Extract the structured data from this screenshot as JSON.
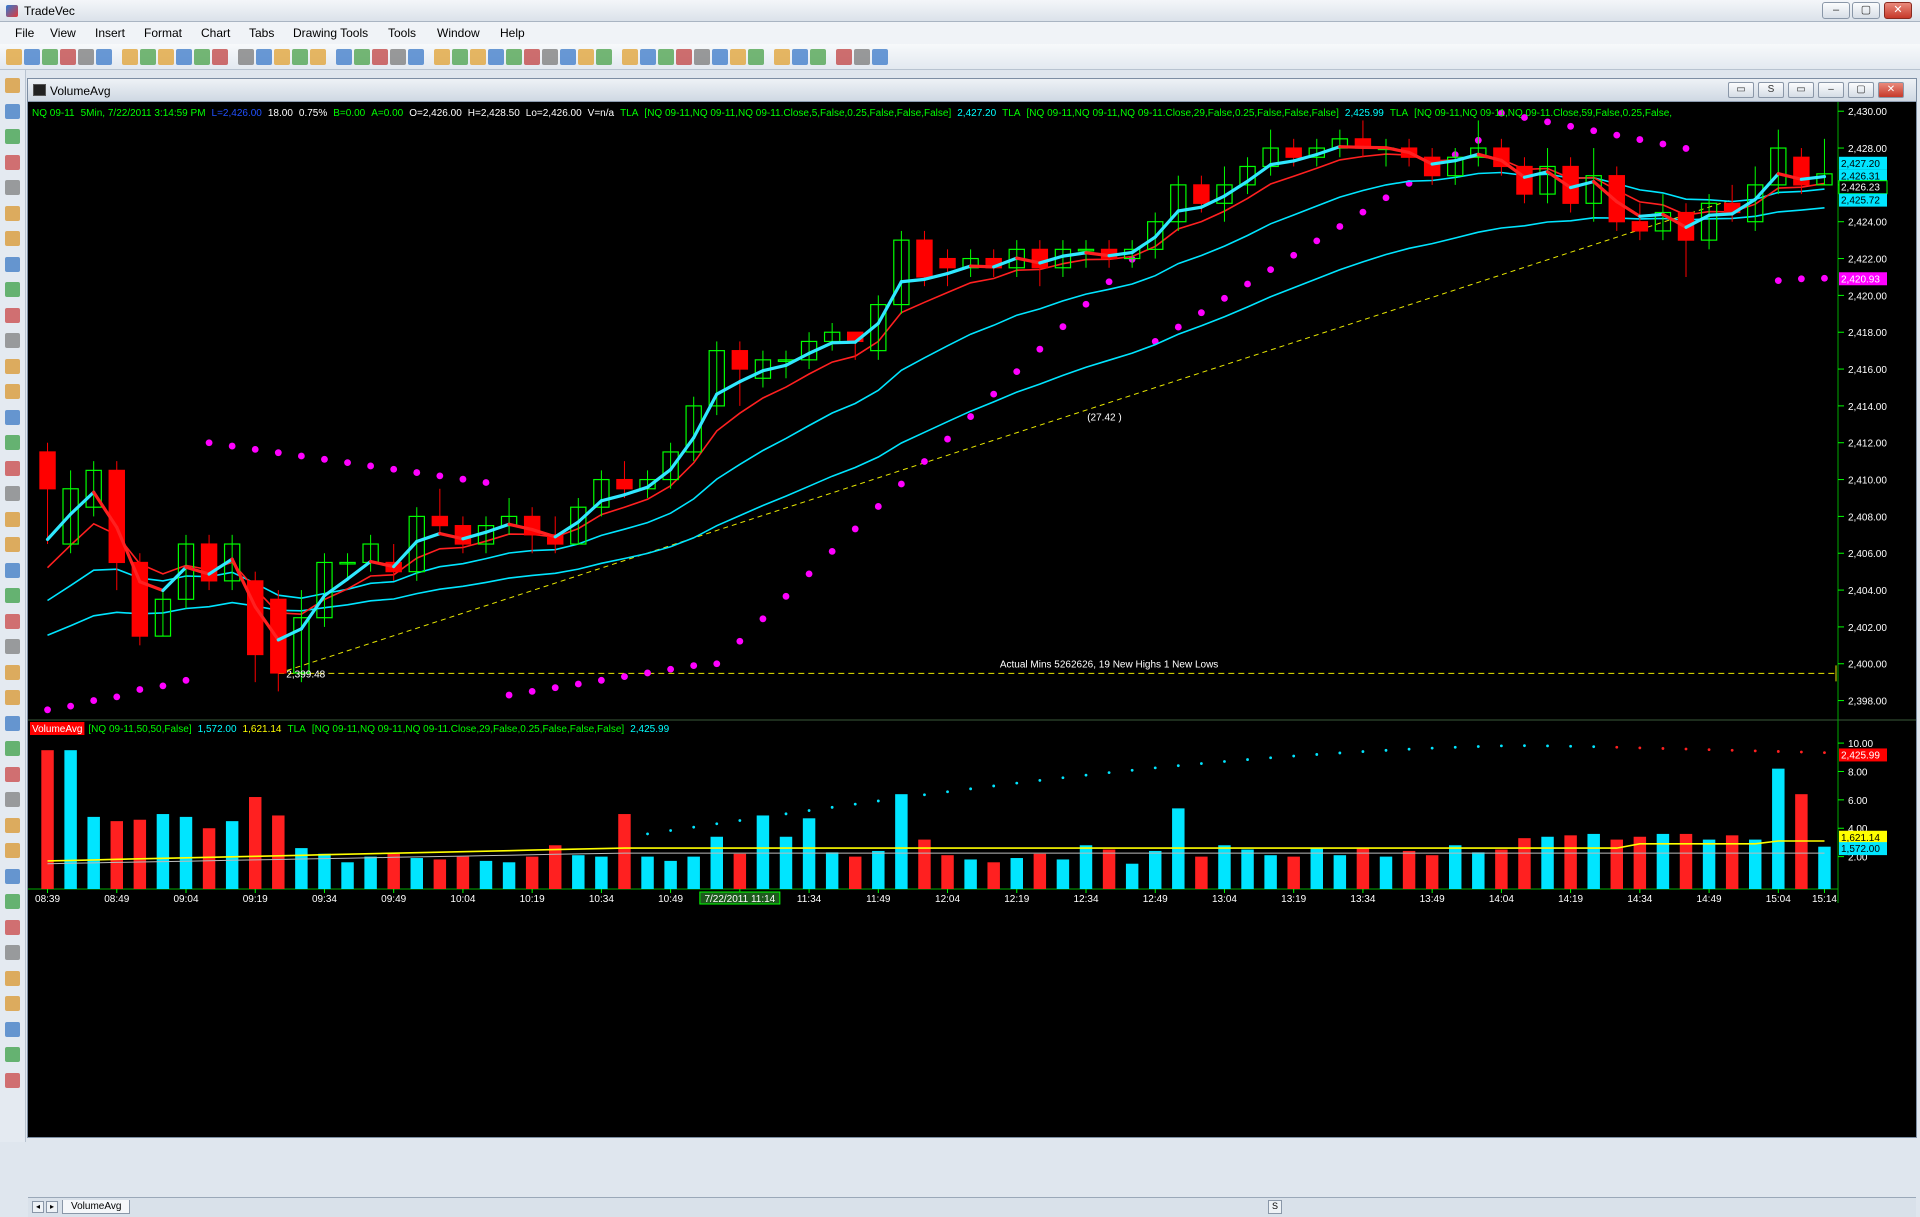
{
  "app": {
    "title": "TradeVec",
    "menu": [
      "File",
      "View",
      "Insert",
      "Format",
      "Chart",
      "Tabs",
      "Drawing Tools",
      "Tools",
      "Window",
      "Help"
    ],
    "window_buttons": [
      "–",
      "▢",
      "✕"
    ]
  },
  "window": {
    "title": "VolumeAvg",
    "tab": "VolumeAvg"
  },
  "colors": {
    "bull": "#00ff00",
    "bear": "#ff0000",
    "cyan": "#00e5ff",
    "yellow": "#ffff00",
    "magenta": "#ff00ff",
    "gridtext": "#ffffff"
  },
  "price_panel": {
    "header": [
      {
        "t": "NQ 09-11",
        "c": "#00ff00"
      },
      {
        "t": "5Min, 7/22/2011  3:14:59 PM",
        "c": "#00ff00"
      },
      {
        "t": "L=2,426.00",
        "c": "#2050ff"
      },
      {
        "t": "18.00",
        "c": "#ffffff"
      },
      {
        "t": "0.75%",
        "c": "#ffffff"
      },
      {
        "t": "B=0.00",
        "c": "#00ff00"
      },
      {
        "t": "A=0.00",
        "c": "#00ff00"
      },
      {
        "t": "O=2,426.00",
        "c": "#ffffff"
      },
      {
        "t": "H=2,428.50",
        "c": "#ffffff"
      },
      {
        "t": "Lo=2,426.00",
        "c": "#ffffff"
      },
      {
        "t": "V=n/a",
        "c": "#ffffff"
      },
      {
        "t": "TLA",
        "c": "#00ff00"
      },
      {
        "t": "[NQ 09-11,NQ 09-11,NQ 09-11.Close,5,False,0.25,False,False,False]",
        "c": "#00ff00"
      },
      {
        "t": "2,427.20",
        "c": "#00ffff"
      },
      {
        "t": "TLA",
        "c": "#00ff00"
      },
      {
        "t": "[NQ 09-11,NQ 09-11,NQ 09-11.Close,29,False,0.25,False,False,False]",
        "c": "#00ff00"
      },
      {
        "t": "2,425.99",
        "c": "#00ffff"
      },
      {
        "t": "TLA",
        "c": "#00ff00"
      },
      {
        "t": "[NQ 09-11,NQ 09-11,NQ 09-11.Close,59,False,0.25,False,",
        "c": "#00ff00"
      }
    ],
    "y_ticks": [
      "2,430.00",
      "2,428.00",
      "2,426.00",
      "2,424.00",
      "2,422.00",
      "2,420.00",
      "2,418.00",
      "2,416.00",
      "2,414.00",
      "2,412.00",
      "2,410.00",
      "2,408.00",
      "2,406.00",
      "2,404.00",
      "2,402.00",
      "2,400.00",
      "2,398.00"
    ],
    "price_labels": [
      {
        "t": "2,427.20",
        "bg": "#00e5ff",
        "fg": "#000000",
        "v": 2427.2
      },
      {
        "t": "2,426.31",
        "bg": "#00e5ff",
        "fg": "#000000",
        "v": 2426.5
      },
      {
        "t": "2,426.23",
        "bg": "#000000",
        "fg": "#ffffff",
        "v": 2425.9,
        "border": "#00ff00"
      },
      {
        "t": "2,425.72",
        "bg": "#00e5ff",
        "fg": "#000000",
        "v": 2425.2
      },
      {
        "t": "2,420.93",
        "bg": "#ff00ff",
        "fg": "#ffffff",
        "v": 2420.93
      }
    ],
    "annotations": {
      "last_price": "2,426.60",
      "low_mark": "2,399.48",
      "trend_value": "(27.42 )",
      "stats": "Actual Mins 5262626, 19 New Highs 1 New Lows"
    }
  },
  "volume_panel": {
    "header": [
      {
        "t": "VolumeAvg",
        "c": "#ffffff",
        "bg": "#ff0000"
      },
      {
        "t": "[NQ 09-11,50,50,False]",
        "c": "#00ff00"
      },
      {
        "t": "1,572.00",
        "c": "#00ffff"
      },
      {
        "t": "1,621.14",
        "c": "#ffff00"
      },
      {
        "t": "TLA",
        "c": "#00ff00"
      },
      {
        "t": "[NQ 09-11,NQ 09-11,NQ 09-11.Close,29,False,0.25,False,False,False]",
        "c": "#00ff00"
      },
      {
        "t": "2,425.99",
        "c": "#00ffff"
      }
    ],
    "y_ticks": [
      "10.00",
      "8.00",
      "6.00",
      "4.00",
      "2.00"
    ],
    "labels": [
      {
        "t": "2,425.99",
        "bg": "#ff0000",
        "fg": "#ffffff"
      },
      {
        "t": "1,621.14",
        "bg": "#ffff00",
        "fg": "#000000"
      },
      {
        "t": "1,572.00",
        "bg": "#00e5ff",
        "fg": "#000000"
      }
    ]
  },
  "x_ticks": [
    {
      "i": 0,
      "t": "08:39"
    },
    {
      "i": 3,
      "t": "08:49"
    },
    {
      "i": 6,
      "t": "09:04"
    },
    {
      "i": 9,
      "t": "09:19"
    },
    {
      "i": 12,
      "t": "09:34"
    },
    {
      "i": 15,
      "t": "09:49"
    },
    {
      "i": 18,
      "t": "10:04"
    },
    {
      "i": 21,
      "t": "10:19"
    },
    {
      "i": 24,
      "t": "10:34"
    },
    {
      "i": 27,
      "t": "10:49"
    },
    {
      "i": 30,
      "t": "7/22/2011 11:14",
      "hl": true
    },
    {
      "i": 33,
      "t": "11:34"
    },
    {
      "i": 36,
      "t": "11:49"
    },
    {
      "i": 39,
      "t": "12:04"
    },
    {
      "i": 42,
      "t": "12:19"
    },
    {
      "i": 45,
      "t": "12:34"
    },
    {
      "i": 48,
      "t": "12:49"
    },
    {
      "i": 51,
      "t": "13:04"
    },
    {
      "i": 54,
      "t": "13:19"
    },
    {
      "i": 57,
      "t": "13:34"
    },
    {
      "i": 60,
      "t": "13:49"
    },
    {
      "i": 63,
      "t": "14:04"
    },
    {
      "i": 66,
      "t": "14:19"
    },
    {
      "i": 69,
      "t": "14:34"
    },
    {
      "i": 72,
      "t": "14:49"
    },
    {
      "i": 75,
      "t": "15:04"
    },
    {
      "i": 77,
      "t": "15:14"
    }
  ],
  "chart_data": {
    "type": "candlestick",
    "symbol": "NQ 09-11",
    "interval": "5Min",
    "ylim": [
      2397,
      2430.5
    ],
    "candles": [
      [
        2411.5,
        2409.5,
        2412,
        2406.5
      ],
      [
        2406.5,
        2409.5,
        2410.5,
        2406
      ],
      [
        2408.5,
        2410.5,
        2411,
        2408
      ],
      [
        2410.5,
        2405.5,
        2411,
        2404
      ],
      [
        2405.5,
        2401.5,
        2406,
        2401
      ],
      [
        2401.5,
        2403.5,
        2404,
        2401.5
      ],
      [
        2403.5,
        2406.5,
        2407,
        2403
      ],
      [
        2406.5,
        2404.5,
        2407,
        2404
      ],
      [
        2404.5,
        2406.5,
        2407,
        2404
      ],
      [
        2404.5,
        2400.5,
        2405,
        2399
      ],
      [
        2403.5,
        2399.5,
        2404,
        2398.5
      ],
      [
        2399.5,
        2402.5,
        2404,
        2399
      ],
      [
        2402.5,
        2405.5,
        2406,
        2402
      ],
      [
        2405.5,
        2405.5,
        2406,
        2404.5
      ],
      [
        2405.5,
        2406.5,
        2407,
        2405
      ],
      [
        2405.5,
        2405,
        2406.5,
        2404.5
      ],
      [
        2405,
        2408,
        2408.5,
        2404.5
      ],
      [
        2408,
        2407.5,
        2409.5,
        2407
      ],
      [
        2407.5,
        2406.5,
        2408,
        2406
      ],
      [
        2406.5,
        2407.5,
        2408,
        2406
      ],
      [
        2407.5,
        2408,
        2409,
        2407
      ],
      [
        2408,
        2407,
        2408.5,
        2406
      ],
      [
        2407,
        2406.5,
        2408,
        2406
      ],
      [
        2406.5,
        2408.5,
        2409,
        2406.5
      ],
      [
        2408.5,
        2410,
        2410.5,
        2408
      ],
      [
        2410,
        2409.5,
        2411,
        2409
      ],
      [
        2409.5,
        2410,
        2410.5,
        2409
      ],
      [
        2410,
        2411.5,
        2412,
        2409.5
      ],
      [
        2411.5,
        2414,
        2414.5,
        2411
      ],
      [
        2414,
        2417,
        2417.5,
        2413.5
      ],
      [
        2417,
        2416,
        2417.5,
        2414
      ],
      [
        2415.5,
        2416.5,
        2417,
        2415
      ],
      [
        2416.5,
        2416.5,
        2417,
        2415.5
      ],
      [
        2416.5,
        2417.5,
        2418,
        2416
      ],
      [
        2417.5,
        2418,
        2418.5,
        2417
      ],
      [
        2418,
        2417.5,
        2418,
        2416.5
      ],
      [
        2417,
        2419.5,
        2420,
        2416.5
      ],
      [
        2419.5,
        2423,
        2423.5,
        2419
      ],
      [
        2423,
        2421,
        2423.5,
        2420.5
      ],
      [
        2422,
        2421.5,
        2422.5,
        2420.5
      ],
      [
        2421.5,
        2422,
        2422.5,
        2421
      ],
      [
        2422,
        2421.5,
        2422.5,
        2421
      ],
      [
        2421.5,
        2422.5,
        2423,
        2421
      ],
      [
        2422.5,
        2421.5,
        2423,
        2420.5
      ],
      [
        2421.5,
        2422.5,
        2423,
        2421
      ],
      [
        2422.5,
        2422.5,
        2423,
        2421.5
      ],
      [
        2422.5,
        2422,
        2423,
        2421.5
      ],
      [
        2422,
        2422.5,
        2423,
        2421.5
      ],
      [
        2422.5,
        2424,
        2424.5,
        2422
      ],
      [
        2424,
        2426,
        2426.5,
        2423.5
      ],
      [
        2426,
        2425,
        2426.5,
        2424.5
      ],
      [
        2425,
        2426,
        2427,
        2424
      ],
      [
        2426,
        2427,
        2427.5,
        2425.5
      ],
      [
        2427,
        2428,
        2429,
        2426.5
      ],
      [
        2428,
        2427.5,
        2428.5,
        2427
      ],
      [
        2427.5,
        2428,
        2428.5,
        2427
      ],
      [
        2428,
        2428.5,
        2429,
        2427.5
      ],
      [
        2428.5,
        2428,
        2429.5,
        2427.5
      ],
      [
        2428,
        2428,
        2428.5,
        2427
      ],
      [
        2428,
        2427.5,
        2428.5,
        2427
      ],
      [
        2427.5,
        2426.5,
        2428,
        2426
      ],
      [
        2426.5,
        2427.5,
        2428,
        2426
      ],
      [
        2427.5,
        2428,
        2429.5,
        2427
      ],
      [
        2428,
        2427,
        2428.5,
        2426.5
      ],
      [
        2427,
        2425.5,
        2427.5,
        2425
      ],
      [
        2425.5,
        2427,
        2428,
        2425
      ],
      [
        2427,
        2425,
        2427.5,
        2424.5
      ],
      [
        2425,
        2426.5,
        2428,
        2424
      ],
      [
        2426.5,
        2424,
        2427,
        2423.5
      ],
      [
        2424,
        2423.5,
        2425,
        2423
      ],
      [
        2423.5,
        2424.5,
        2425.5,
        2423
      ],
      [
        2424.5,
        2423,
        2425,
        2421
      ],
      [
        2423,
        2425,
        2425.5,
        2422.5
      ],
      [
        2425,
        2424.5,
        2426,
        2424
      ],
      [
        2424,
        2426,
        2427,
        2423.5
      ],
      [
        2426,
        2428,
        2429,
        2425.5
      ],
      [
        2427.5,
        2426,
        2428,
        2425.5
      ],
      [
        2426,
        2426.6,
        2428.5,
        2426
      ]
    ],
    "volume": [
      9.5,
      9.5,
      4.8,
      4.5,
      4.6,
      5.0,
      4.8,
      4.0,
      4.5,
      6.2,
      4.9,
      2.6,
      2.2,
      1.6,
      2.0,
      2.2,
      1.9,
      1.8,
      2.0,
      1.7,
      1.6,
      2.0,
      2.8,
      2.1,
      2.0,
      5.0,
      2.0,
      1.7,
      2.0,
      3.4,
      2.2,
      4.9,
      3.4,
      4.7,
      2.3,
      2.0,
      2.4,
      6.4,
      3.2,
      2.1,
      1.8,
      1.6,
      1.9,
      2.2,
      1.8,
      2.8,
      2.5,
      1.5,
      2.4,
      5.4,
      2.0,
      2.8,
      2.5,
      2.1,
      2.0,
      2.6,
      2.1,
      2.6,
      2.0,
      2.4,
      2.1,
      2.8,
      2.3,
      2.5,
      3.3,
      3.4,
      3.5,
      3.6,
      3.2,
      3.4,
      3.6,
      3.6,
      3.2,
      3.5,
      3.2,
      8.2,
      6.4,
      2.7
    ],
    "vol_ylim": [
      0,
      10.5
    ]
  }
}
